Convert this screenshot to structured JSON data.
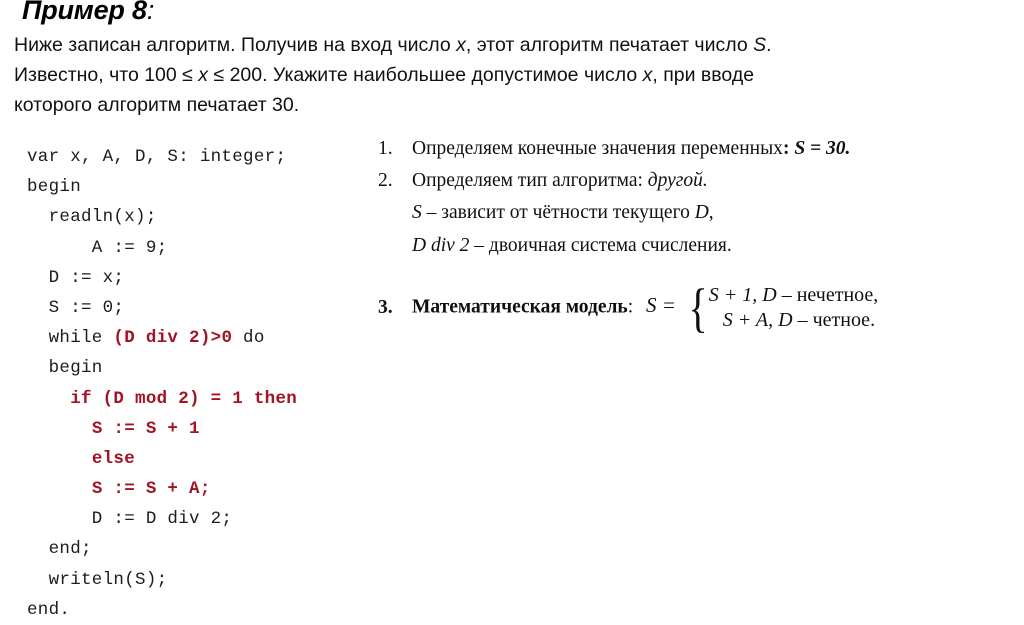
{
  "title": {
    "text": "Пример 8",
    "colon": ":"
  },
  "problem": {
    "line1_a": " Ниже записан алгоритм. Получив на вход число ",
    "line1_var": "x",
    "line1_b": ", этот алгоритм печатает число ",
    "line1_var2": "S",
    "line1_c": ".",
    "line2_a": "Известно, что 100 ≤ ",
    "line2_var": "x",
    "line2_b": " ≤ 200. Укажите наибольшее допустимое число ",
    "line2_var2": "x",
    "line2_c": ", при вводе",
    "line3": "которого алгоритм печатает 30."
  },
  "code": {
    "lines": [
      {
        "segments": [
          {
            "t": "var x, A, D, S: integer;",
            "c": "black"
          }
        ]
      },
      {
        "segments": [
          {
            "t": "begin",
            "c": "black"
          }
        ]
      },
      {
        "segments": [
          {
            "t": "  readln(x);",
            "c": "black"
          }
        ]
      },
      {
        "segments": [
          {
            "t": "      A := 9;",
            "c": "black"
          }
        ]
      },
      {
        "segments": [
          {
            "t": "  D := x;",
            "c": "black"
          }
        ]
      },
      {
        "segments": [
          {
            "t": "  S := 0;",
            "c": "black"
          }
        ]
      },
      {
        "segments": [
          {
            "t": "  while ",
            "c": "black"
          },
          {
            "t": "(D div 2)>0",
            "c": "red"
          },
          {
            "t": " do",
            "c": "black"
          }
        ]
      },
      {
        "segments": [
          {
            "t": "  begin",
            "c": "black"
          }
        ]
      },
      {
        "segments": [
          {
            "t": "    ",
            "c": "black"
          },
          {
            "t": "if (D mod 2) = 1 then",
            "c": "red"
          }
        ]
      },
      {
        "segments": [
          {
            "t": "      ",
            "c": "black"
          },
          {
            "t": "S := S + 1",
            "c": "red"
          }
        ]
      },
      {
        "segments": [
          {
            "t": "      ",
            "c": "black"
          },
          {
            "t": "else",
            "c": "red"
          }
        ]
      },
      {
        "segments": [
          {
            "t": "      ",
            "c": "black"
          },
          {
            "t": "S := S + A;",
            "c": "red"
          }
        ]
      },
      {
        "segments": [
          {
            "t": "      D := D div 2;",
            "c": "black"
          }
        ]
      },
      {
        "segments": [
          {
            "t": "  end;",
            "c": "black"
          }
        ]
      },
      {
        "segments": [
          {
            "t": "  writeln(S);",
            "c": "black"
          }
        ]
      },
      {
        "segments": [
          {
            "t": "end.",
            "c": "black"
          }
        ]
      }
    ],
    "accent_color": "#A21325"
  },
  "solution": {
    "item1": {
      "num": "1.",
      "text": "Определяем конечные значения переменных",
      "colon": ": ",
      "value": "S = 30."
    },
    "item2": {
      "num": "2.",
      "text": "Определяем тип алгоритма: ",
      "value": "другой."
    },
    "sub1": {
      "var": "S",
      "text": " – зависит от чётности текущего ",
      "var2": "D",
      "tail": ","
    },
    "sub2": {
      "var": "D  div 2",
      "text": " – двоичная система счисления."
    },
    "item3": {
      "num": "3.",
      "label": "Математическая модель",
      "colon": ":",
      "lhs": "S =",
      "case1": "S + 1, D",
      "case1_word": " – нечетное,",
      "case2": "S + A, D",
      "case2_word": " – четное.",
      "brace": "{"
    }
  }
}
